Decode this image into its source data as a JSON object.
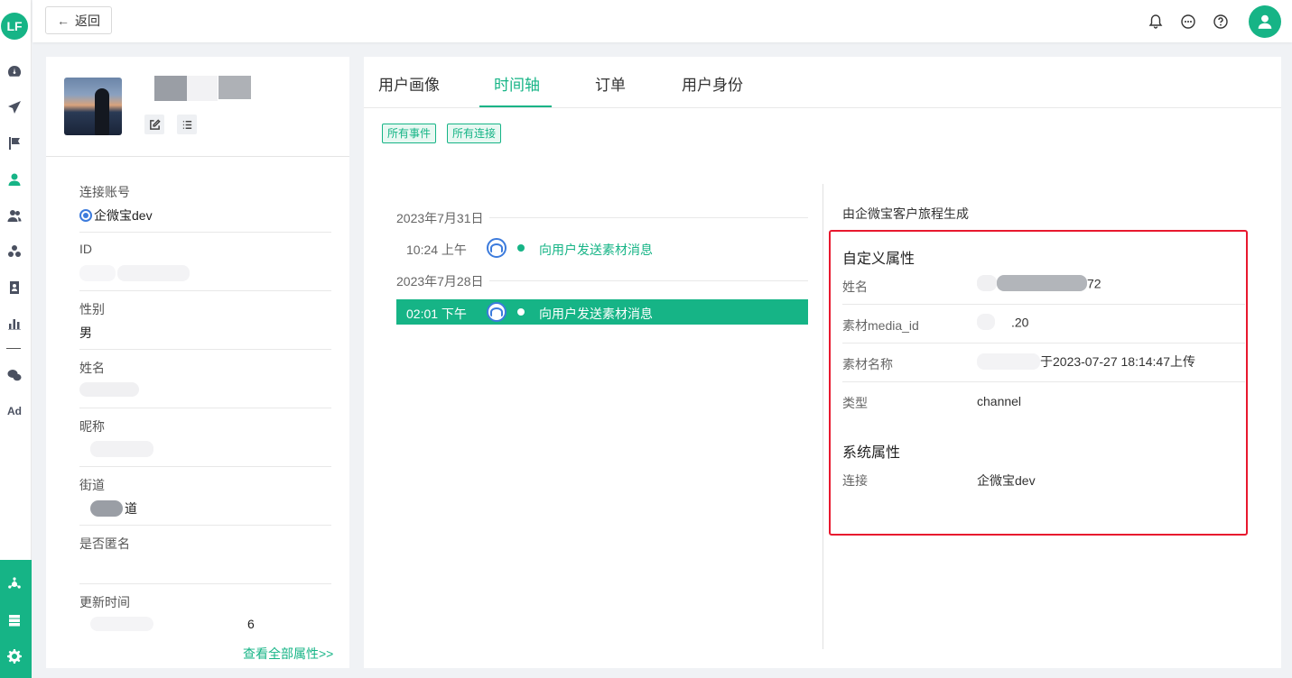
{
  "app": {
    "logo_text": "LF",
    "brand_color": "#16b486"
  },
  "rail": {
    "items": [
      {
        "icon": "dashboard-icon"
      },
      {
        "icon": "send-icon"
      },
      {
        "icon": "flag-icon"
      },
      {
        "icon": "user-icon",
        "active": true
      },
      {
        "icon": "users-icon"
      },
      {
        "icon": "segments-icon"
      },
      {
        "icon": "contact-card-icon"
      },
      {
        "icon": "bar-chart-icon"
      },
      {
        "icon": "wechat-icon"
      },
      {
        "icon": "ad-icon",
        "label": "Ad"
      }
    ],
    "bottom_items": [
      {
        "icon": "integration-icon"
      },
      {
        "icon": "server-icon"
      },
      {
        "icon": "settings-gear-icon"
      }
    ]
  },
  "topbar": {
    "back_label": "返回",
    "icons": [
      "bell-icon",
      "message-icon",
      "help-icon",
      "user-avatar-icon"
    ]
  },
  "profile": {
    "fields": [
      {
        "label": "连接账号",
        "value": "企微宝dev",
        "has_icon": true
      },
      {
        "label": "ID",
        "value": ""
      },
      {
        "label": "性别",
        "value": "男"
      },
      {
        "label": "姓名",
        "value": ""
      },
      {
        "label": "昵称",
        "value": ""
      },
      {
        "label": "街道",
        "value": "道"
      },
      {
        "label": "是否匿名",
        "value": ""
      },
      {
        "label": "更新时间",
        "value": "6"
      }
    ],
    "view_all": "查看全部属性>>"
  },
  "tabs": [
    {
      "label": "用户画像",
      "active": false
    },
    {
      "label": "时间轴",
      "active": true
    },
    {
      "label": "订单",
      "active": false
    },
    {
      "label": "用户身份",
      "active": false
    }
  ],
  "filters": [
    "所有事件",
    "所有连接"
  ],
  "timeline": {
    "groups": [
      {
        "date": "2023年7月31日",
        "events": [
          {
            "time": "10:24 上午",
            "name": "向用户发送素材消息",
            "selected": false
          }
        ]
      },
      {
        "date": "2023年7月28日",
        "events": [
          {
            "time": "02:01 下午",
            "name": "向用户发送素材消息",
            "selected": true
          }
        ]
      }
    ]
  },
  "detail": {
    "origin": "由企微宝客户旅程生成",
    "custom_title": "自定义属性",
    "custom_attrs": [
      {
        "key": "姓名",
        "value": "72"
      },
      {
        "key": "素材media_id",
        "value": ".20"
      },
      {
        "key": "素材名称",
        "value": "于2023-07-27 18:14:47上传"
      },
      {
        "key": "类型",
        "value": "channel"
      }
    ],
    "system_title": "系统属性",
    "system_attrs": [
      {
        "key": "连接",
        "value": "企微宝dev"
      }
    ],
    "highlight_color": "#e8182e"
  }
}
